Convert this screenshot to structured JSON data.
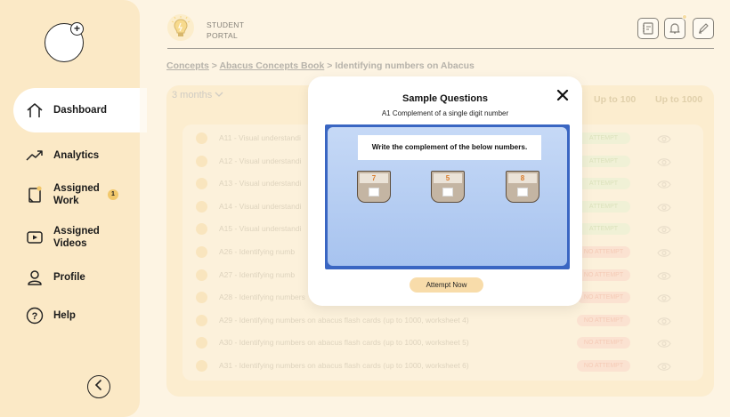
{
  "sidebar": {
    "items": [
      {
        "label": "Dashboard",
        "icon": "home-icon"
      },
      {
        "label": "Analytics",
        "icon": "analytics-icon"
      },
      {
        "label": "Assigned Work",
        "icon": "assigned-work-icon",
        "badge": "1"
      },
      {
        "label": "Assigned Videos",
        "icon": "video-icon"
      },
      {
        "label": "Profile",
        "icon": "user-icon"
      },
      {
        "label": "Help",
        "icon": "help-icon"
      }
    ],
    "active": "Dashboard"
  },
  "header": {
    "brand_line1": "STUDENT",
    "brand_line2": "PORTAL"
  },
  "breadcrumb": {
    "items": [
      "Concepts",
      "Abacus Concepts Book",
      "Identifying numbers on Abacus"
    ],
    "separator": ">"
  },
  "filter": {
    "label": "3 months"
  },
  "table": {
    "columns": [
      "Up to 100",
      "Up to 1000"
    ],
    "rows": [
      {
        "text": "A11 - Visual understandi",
        "status": "ATTEMPT",
        "status_type": "green"
      },
      {
        "text": "A12 - Visual understandi",
        "status": "ATTEMPT",
        "status_type": "green"
      },
      {
        "text": "A13 - Visual understandi",
        "status": "ATTEMPT",
        "status_type": "green"
      },
      {
        "text": "A14 - Visual understandi",
        "status": "ATTEMPT",
        "status_type": "green"
      },
      {
        "text": "A15 - Visual understandi",
        "status": "ATTEMPT",
        "status_type": "green"
      },
      {
        "text": "A26 - Identifying numb",
        "status": "NO ATTEMPT",
        "status_type": "red"
      },
      {
        "text": "A27 - Identifying numb",
        "status": "NO ATTEMPT",
        "status_type": "red"
      },
      {
        "text": "A28 - Identifying numbers",
        "status": "NO ATTEMPT",
        "status_type": "red"
      },
      {
        "text": "A29 - Identifying numbers on abacus flash cards (up to 1000, worksheet 4)",
        "status": "NO ATTEMPT",
        "status_type": "red"
      },
      {
        "text": "A30 - Identifying numbers on abacus flash cards (up to 1000, worksheet 5)",
        "status": "NO ATTEMPT",
        "status_type": "red"
      },
      {
        "text": "A31 - Identifying numbers on abacus flash cards (up to 1000, worksheet 6)",
        "status": "NO ATTEMPT",
        "status_type": "red"
      }
    ]
  },
  "modal": {
    "title": "Sample Questions",
    "subtitle": "A1 Complement of a single digit number",
    "question": "Write the complement of the below numbers.",
    "numbers": [
      "7",
      "5",
      "8"
    ],
    "attempt_label": "Attempt Now"
  },
  "colors": {
    "accent": "#f8dcaa",
    "sidebar_bg": "#fbe9c6",
    "page_bg": "#fdf4e3",
    "preview_border": "#3a66c2",
    "number_color": "#d87a2a"
  }
}
